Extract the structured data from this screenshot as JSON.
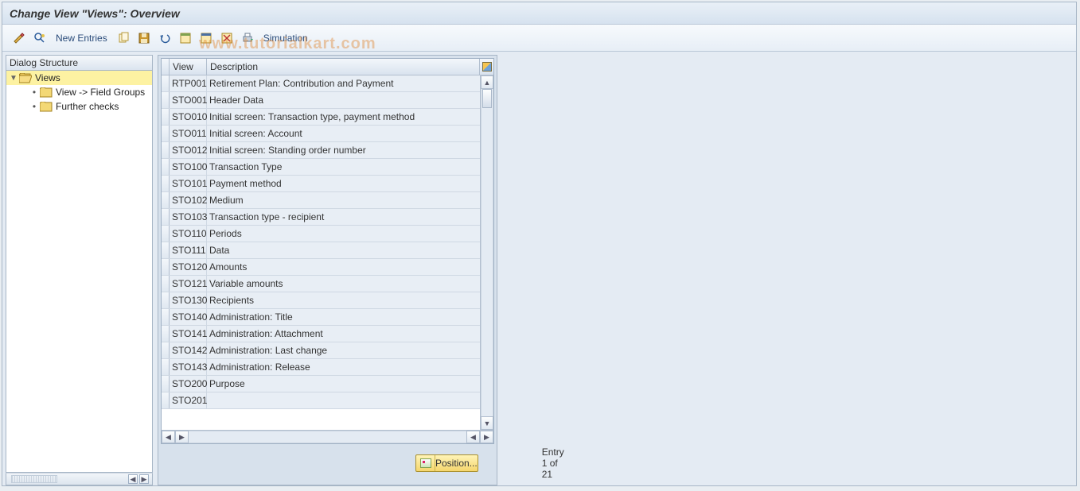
{
  "title": "Change View \"Views\": Overview",
  "watermark": "www.tutorialkart.com",
  "toolbar": {
    "new_entries": "New Entries",
    "simulation": "Simulation"
  },
  "tree": {
    "header": "Dialog Structure",
    "root": "Views",
    "child1": "View -> Field Groups",
    "child2": "Further checks"
  },
  "grid": {
    "col_view": "View",
    "col_desc": "Description",
    "rows": [
      {
        "view": "RTP001",
        "desc": "Retirement Plan: Contribution and Payment"
      },
      {
        "view": "STO001",
        "desc": "Header Data"
      },
      {
        "view": "STO010",
        "desc": "Initial screen: Transaction type, payment method"
      },
      {
        "view": "STO011",
        "desc": "Initial screen: Account"
      },
      {
        "view": "STO012",
        "desc": "Initial screen: Standing order number"
      },
      {
        "view": "STO100",
        "desc": "Transaction Type"
      },
      {
        "view": "STO101",
        "desc": "Payment method"
      },
      {
        "view": "STO102",
        "desc": "Medium"
      },
      {
        "view": "STO103",
        "desc": "Transaction type - recipient"
      },
      {
        "view": "STO110",
        "desc": "Periods"
      },
      {
        "view": "STO111",
        "desc": "Data"
      },
      {
        "view": "STO120",
        "desc": "Amounts"
      },
      {
        "view": "STO121",
        "desc": "Variable amounts"
      },
      {
        "view": "STO130",
        "desc": "Recipients"
      },
      {
        "view": "STO140",
        "desc": "Administration: Title"
      },
      {
        "view": "STO141",
        "desc": "Administration: Attachment"
      },
      {
        "view": "STO142",
        "desc": "Administration: Last change"
      },
      {
        "view": "STO143",
        "desc": "Administration: Release"
      },
      {
        "view": "STO200",
        "desc": "Purpose"
      },
      {
        "view": "STO201",
        "desc": ""
      }
    ]
  },
  "footer": {
    "position_label": "Position...",
    "entry_text": "Entry 1 of 21"
  }
}
